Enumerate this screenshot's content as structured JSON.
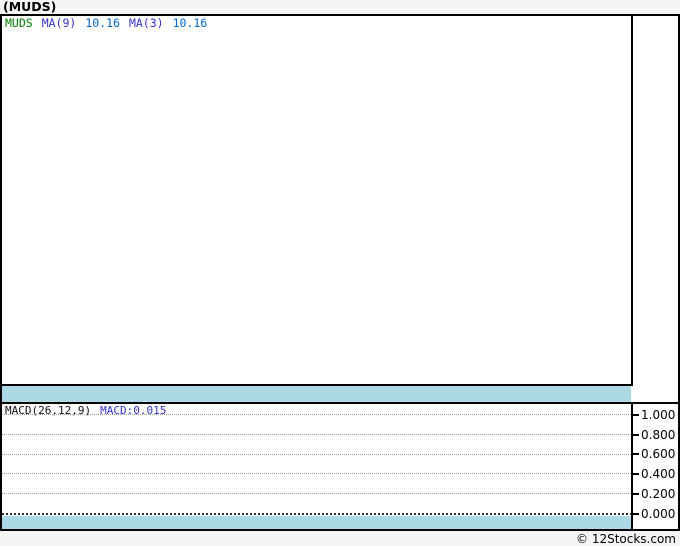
{
  "page": {
    "title": "(MUDS)",
    "footer": "© 12Stocks.com"
  },
  "colors": {
    "background": "#f5f5f5",
    "panel_background": "#ffffff",
    "border": "#000000",
    "separator_band": "#add8e6",
    "ticker_text": "#008000",
    "ma_text": "#3333cc",
    "value_text": "#0066cc",
    "macd_value_text": "#3333cc",
    "gridline": "#9a9a9a"
  },
  "price_panel": {
    "legend": {
      "ticker": "MUDS",
      "ma9_label": "MA(9)",
      "ma9_value": "10.16",
      "ma3_label": "MA(3)",
      "ma3_value": "10.16"
    }
  },
  "macd_panel": {
    "legend": {
      "label": "MACD(26,12,9)",
      "value_label": "MACD:0.015"
    },
    "yticks": [
      "1.000",
      "0.800",
      "0.600",
      "0.400",
      "0.200",
      "0.000"
    ]
  },
  "chart_data": [
    {
      "type": "line",
      "title": "MUDS price panel",
      "series": [
        {
          "name": "MA(9)",
          "last_value": 10.16
        },
        {
          "name": "MA(3)",
          "last_value": 10.16
        }
      ],
      "annotations": [
        "MUDS",
        "MA(9)",
        "10.16",
        "MA(3)",
        "10.16"
      ],
      "grid": false,
      "note": "plot area empty - no price curve rendered in screenshot"
    },
    {
      "type": "line",
      "title": "MACD(26,12,9)",
      "series": [
        {
          "name": "MACD",
          "last_value": 0.015
        }
      ],
      "ylabel": "",
      "yticks": [
        1.0,
        0.8,
        0.6,
        0.4,
        0.2,
        0.0
      ],
      "ylim": [
        -0.15,
        1.12
      ],
      "grid": true,
      "legend_position": "top-left",
      "note": "horizontal dotted gridlines with darker zero line; no MACD curve visible"
    }
  ]
}
